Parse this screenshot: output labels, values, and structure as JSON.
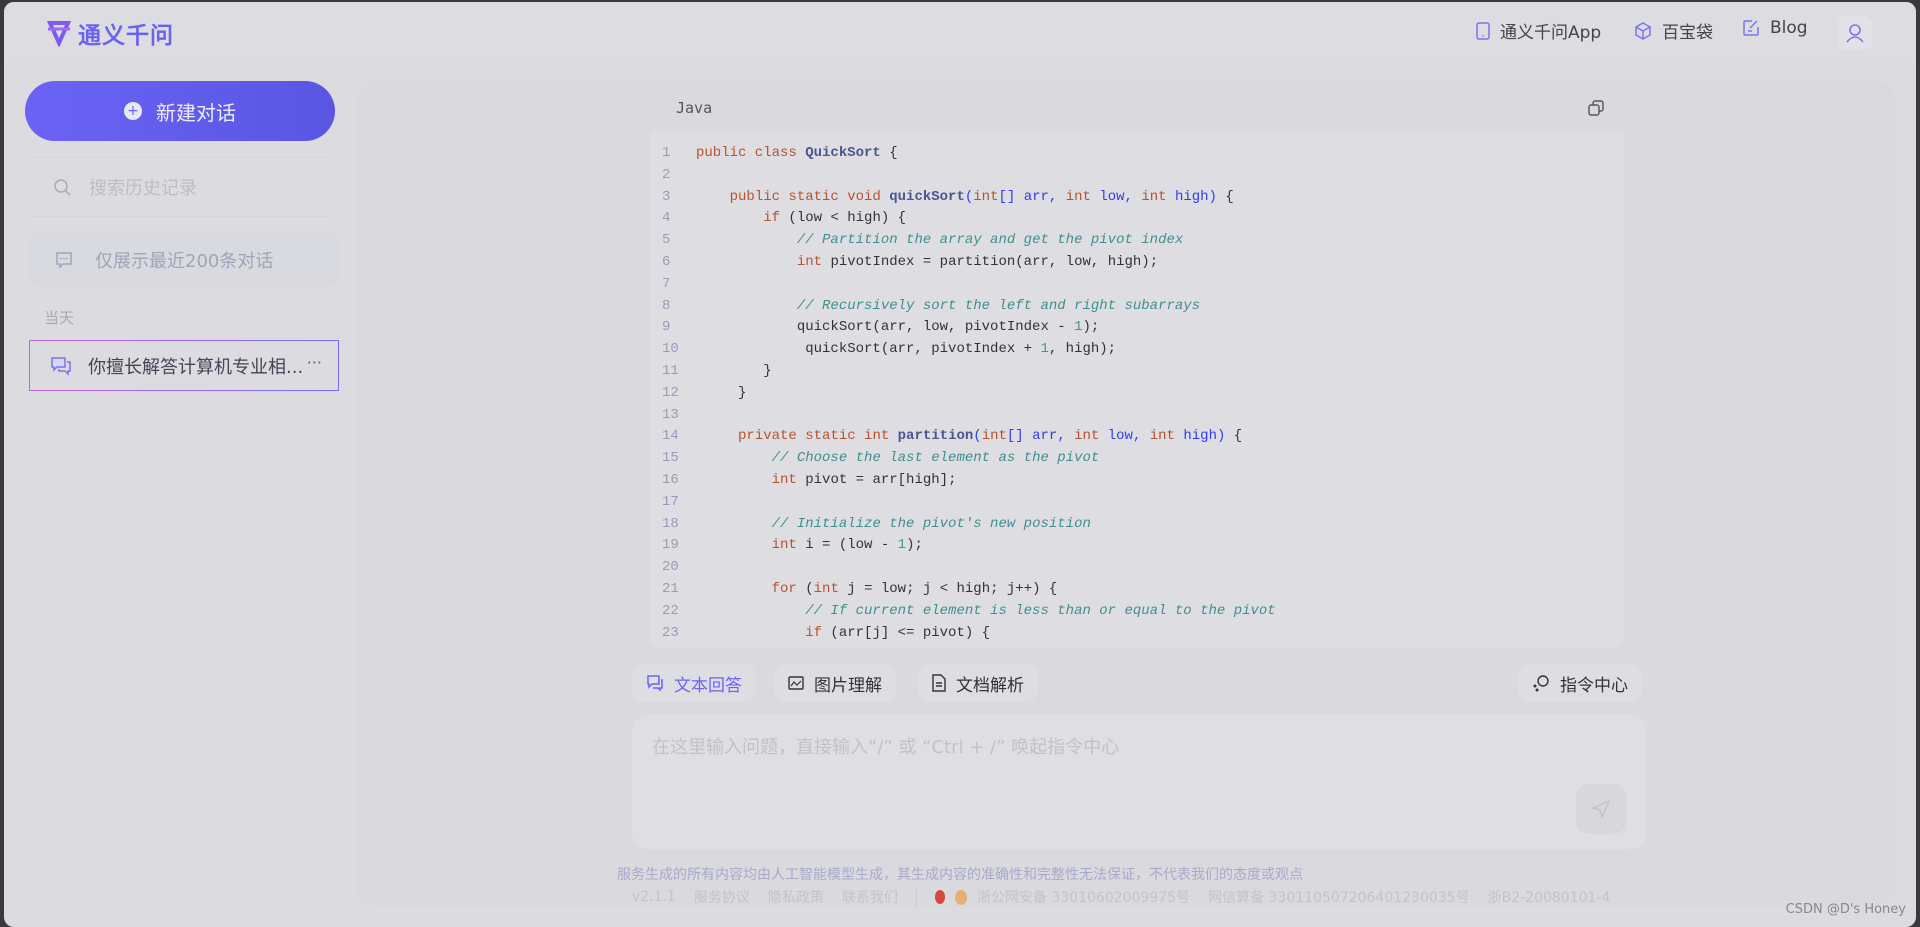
{
  "header": {
    "logo_text": "通义千问",
    "nav": [
      {
        "icon": "phone-icon",
        "label": "通义千问App"
      },
      {
        "icon": "cube-icon",
        "label": "百宝袋"
      },
      {
        "icon": "edit-icon",
        "label": "Blog"
      }
    ],
    "user_icon": "user-icon"
  },
  "sidebar": {
    "new_chat": "新建对话",
    "search_placeholder": "搜索历史记录",
    "notice": "仅展示最近200条对话",
    "group_label": "当天",
    "conversations": [
      {
        "title": "你擅长解答计算机专业相...",
        "more": "···"
      }
    ]
  },
  "code_block": {
    "language": "Java",
    "lines": [
      [
        [
          "kw",
          "public class "
        ],
        [
          "fn",
          "QuickSort"
        ],
        [
          "pl",
          " {"
        ]
      ],
      [],
      [
        [
          "pl",
          "    "
        ],
        [
          "kw",
          "public static void "
        ],
        [
          "fn",
          "quickSort"
        ],
        [
          "pa",
          "("
        ],
        [
          "kw",
          "int"
        ],
        [
          "pa",
          "[] arr, "
        ],
        [
          "kw",
          "int "
        ],
        [
          "pa",
          "low, "
        ],
        [
          "kw",
          "int "
        ],
        [
          "pa",
          "high)"
        ],
        [
          "pl",
          " {"
        ]
      ],
      [
        [
          "pl",
          "        "
        ],
        [
          "kw",
          "if"
        ],
        [
          "pl",
          " (low < high) {"
        ]
      ],
      [
        [
          "pl",
          "            "
        ],
        [
          "cm",
          "// Partition the array and get the pivot index"
        ]
      ],
      [
        [
          "pl",
          "            "
        ],
        [
          "kw",
          "int"
        ],
        [
          "pl",
          " pivotIndex = partition(arr, low, high);"
        ]
      ],
      [],
      [
        [
          "pl",
          "            "
        ],
        [
          "cm",
          "// Recursively sort the left and right subarrays"
        ]
      ],
      [
        [
          "pl",
          "            quickSort(arr, low, pivotIndex - "
        ],
        [
          "nu",
          "1"
        ],
        [
          "pl",
          ");"
        ]
      ],
      [
        [
          "pl",
          "             quickSort(arr, pivotIndex + "
        ],
        [
          "nu",
          "1"
        ],
        [
          "pl",
          ", high);"
        ]
      ],
      [
        [
          "pl",
          "        }"
        ]
      ],
      [
        [
          "pl",
          "     }"
        ]
      ],
      [],
      [
        [
          "pl",
          "     "
        ],
        [
          "kw",
          "private static int "
        ],
        [
          "fn",
          "partition"
        ],
        [
          "pa",
          "("
        ],
        [
          "kw",
          "int"
        ],
        [
          "pa",
          "[] arr, "
        ],
        [
          "kw",
          "int "
        ],
        [
          "pa",
          "low, "
        ],
        [
          "kw",
          "int "
        ],
        [
          "pa",
          "high)"
        ],
        [
          "pl",
          " {"
        ]
      ],
      [
        [
          "pl",
          "         "
        ],
        [
          "cm",
          "// Choose the last element as the pivot"
        ]
      ],
      [
        [
          "pl",
          "         "
        ],
        [
          "kw",
          "int"
        ],
        [
          "pl",
          " pivot = arr[high];"
        ]
      ],
      [],
      [
        [
          "pl",
          "         "
        ],
        [
          "cm",
          "// Initialize the pivot's new position"
        ]
      ],
      [
        [
          "pl",
          "         "
        ],
        [
          "kw",
          "int"
        ],
        [
          "pl",
          " i = (low - "
        ],
        [
          "nu",
          "1"
        ],
        [
          "pl",
          ");"
        ]
      ],
      [],
      [
        [
          "pl",
          "         "
        ],
        [
          "kw",
          "for"
        ],
        [
          "pl",
          " ("
        ],
        [
          "kw",
          "int"
        ],
        [
          "pl",
          " j = low; j < high; j++) {"
        ]
      ],
      [
        [
          "pl",
          "             "
        ],
        [
          "cm",
          "// If current element is less than or equal to the pivot"
        ]
      ],
      [
        [
          "pl",
          "             "
        ],
        [
          "kw",
          "if"
        ],
        [
          "pl",
          " (arr[j] <= pivot) {"
        ]
      ]
    ]
  },
  "modes": [
    {
      "label": "文本回答",
      "active": true
    },
    {
      "label": "图片理解"
    },
    {
      "label": "文档解析"
    }
  ],
  "command_center": "指令中心",
  "input": {
    "placeholder": "在这里输入问题，直接输入“/” 或 “Ctrl + /” 唤起指令中心"
  },
  "footer": {
    "disclaimer": "服务生成的所有内容均由人工智能模型生成，其生成内容的准确性和完整性无法保证，不代表我们的态度或观点",
    "version": "v2.1.1",
    "links": [
      "服务协议",
      "隐私政策",
      "联系我们"
    ],
    "icp": [
      "浙公网安备 33010602009975号",
      "网信算备 330110507206401230035号",
      "浙B2-20080101-4"
    ]
  },
  "watermark": "CSDN @D's Honey",
  "colors": {
    "accent": "#6b63f5",
    "keyword": "#b5532f",
    "comment": "#3f8f8f",
    "param": "#2f3cf0",
    "number": "#3aa070"
  }
}
